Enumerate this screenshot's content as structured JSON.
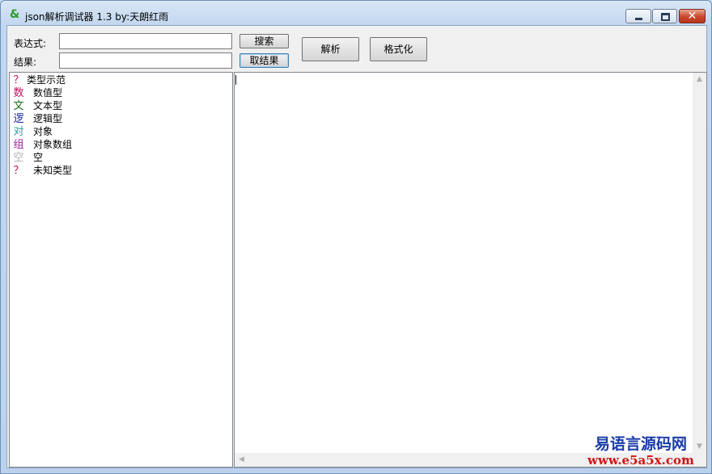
{
  "window": {
    "title": "json解析调试器 1.3   by:天朗红雨",
    "icon": "leaf-icon",
    "controls": {
      "minimize": "minimize-icon",
      "maximize": "maximize-icon",
      "close": "✕"
    }
  },
  "form": {
    "expression_label": "表达式:",
    "expression_value": "",
    "result_label": "结果:",
    "result_value": "",
    "search_button": "搜索",
    "get_result_button": "取结果",
    "parse_button": "解析",
    "format_button": "格式化"
  },
  "tree": {
    "root": {
      "icon": "？",
      "label": "类型示范",
      "color": "#c01060"
    },
    "items": [
      {
        "icon": "数",
        "label": "数值型",
        "color": "#c01060"
      },
      {
        "icon": "文",
        "label": "文本型",
        "color": "#1a6a1a"
      },
      {
        "icon": "逻",
        "label": "逻辑型",
        "color": "#1a2a9a"
      },
      {
        "icon": "对",
        "label": "对象",
        "color": "#20a0a0"
      },
      {
        "icon": "组",
        "label": "对象数组",
        "color": "#9a209a"
      },
      {
        "icon": "空",
        "label": "空",
        "color": "#b0b0b0"
      },
      {
        "icon": "？",
        "label": "未知类型",
        "color": "#c01060"
      }
    ]
  },
  "editor": {
    "content": ""
  },
  "watermark": {
    "name": "易语言源码网",
    "url": "www.e5a5x.com"
  }
}
